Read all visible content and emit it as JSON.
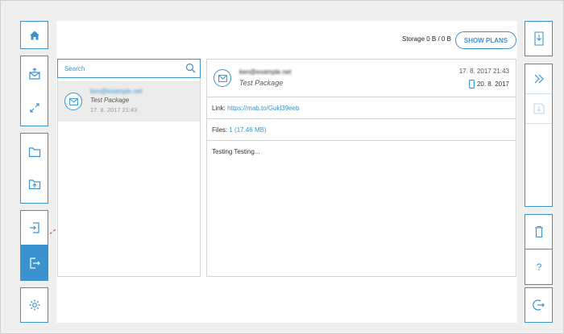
{
  "left_sidebar": {
    "items": [
      {
        "name": "home",
        "icon": "home-icon"
      },
      {
        "name": "send",
        "icon": "send-mail-icon"
      },
      {
        "name": "transfer",
        "icon": "transfer-icon"
      },
      {
        "name": "folder",
        "icon": "folder-icon"
      },
      {
        "name": "upload-folder",
        "icon": "folder-upload-icon"
      },
      {
        "name": "login",
        "icon": "sign-in-icon"
      },
      {
        "name": "logout",
        "icon": "sign-out-icon",
        "active": true
      },
      {
        "name": "settings",
        "icon": "gear-icon"
      }
    ]
  },
  "right_sidebar": {
    "items": [
      {
        "name": "download",
        "icon": "download-icon"
      },
      {
        "name": "forward",
        "icon": "double-chevron-right-icon"
      },
      {
        "name": "save",
        "icon": "save-icon"
      },
      {
        "name": "delete",
        "icon": "trash-icon"
      },
      {
        "name": "help",
        "icon": "question-icon"
      },
      {
        "name": "exit",
        "icon": "exit-icon"
      }
    ]
  },
  "header": {
    "storage": "Storage 0 B / 0 B",
    "show_plans": "SHOW PLANS"
  },
  "search": {
    "placeholder": "Search"
  },
  "list": {
    "items": [
      {
        "sender": "ken@example.net",
        "subject": "Test Package",
        "date": "17. 8. 2017 21:43"
      }
    ]
  },
  "detail": {
    "sender": "ken@example.net",
    "subject": "Test Package",
    "date": "17. 8. 2017 21:43",
    "expiry": "20. 8. 2017",
    "link_label": "Link:",
    "link_url": "https://mab.to/Gukl39eeb",
    "files_label": "Files:",
    "files_count": "1",
    "files_size": "(17.46 MB)",
    "message": "Testing Testing..."
  },
  "colors": {
    "accent": "#3a93cf",
    "border": "#d3d3d3",
    "selected_row": "#ececec"
  }
}
